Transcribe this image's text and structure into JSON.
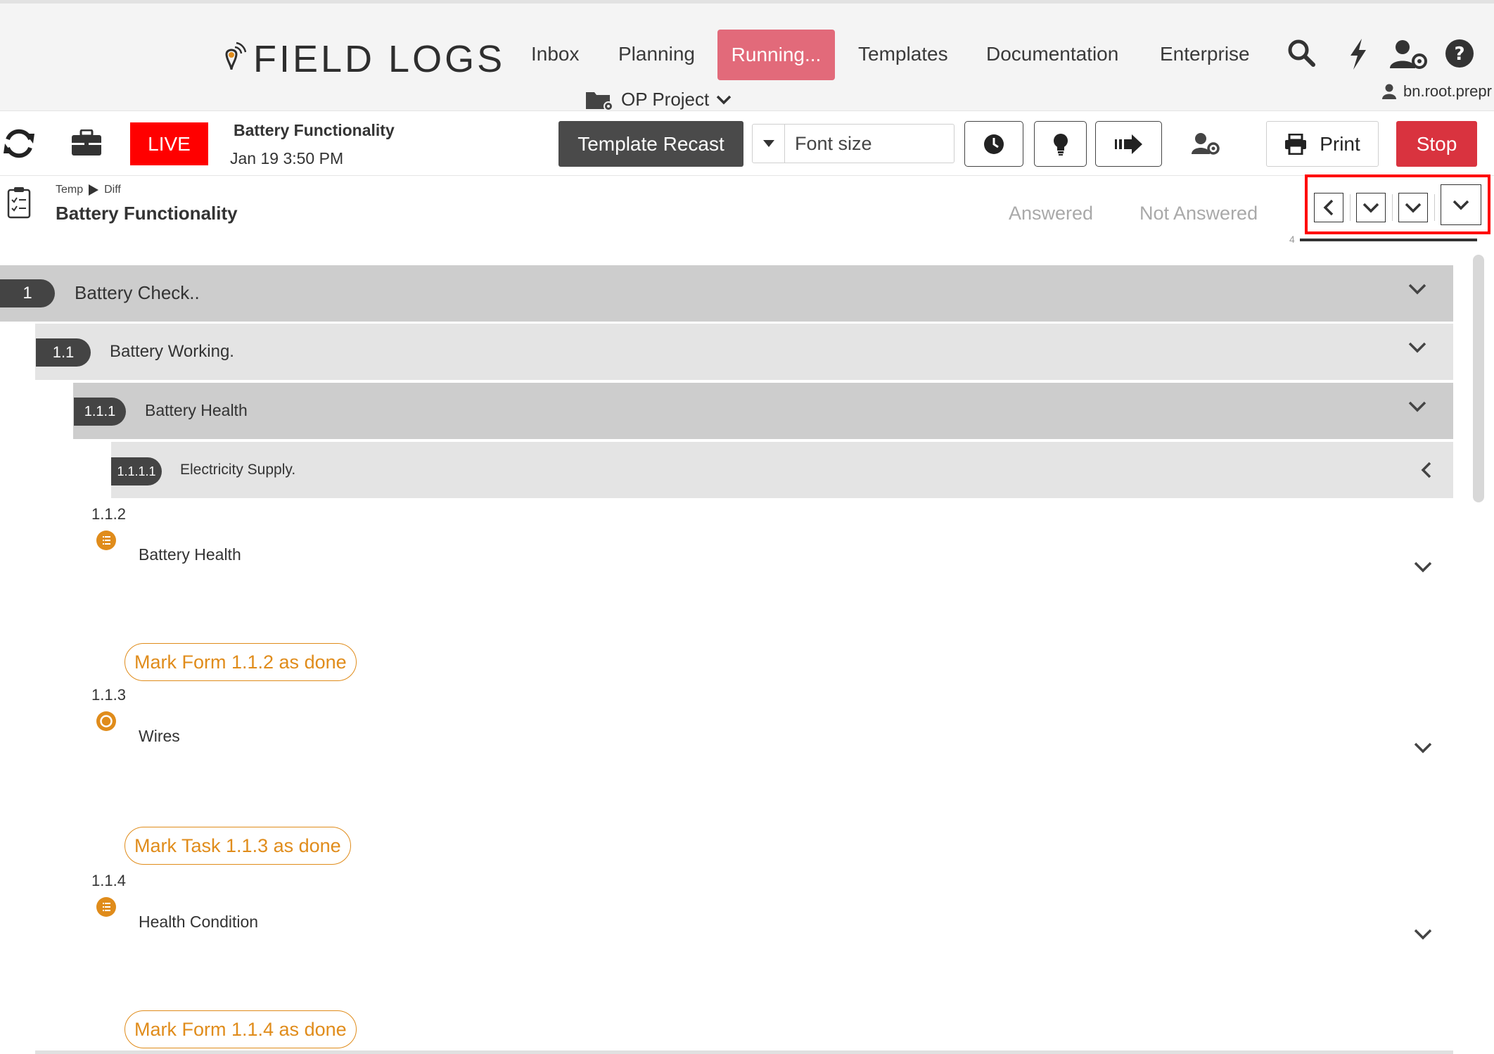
{
  "brand": {
    "name": "FIELD LOGS"
  },
  "nav": {
    "items": [
      "Inbox",
      "Planning",
      "Running...",
      "Templates",
      "Documentation",
      "Enterprise"
    ],
    "project": "OP Project",
    "user": "bn.root.prepr"
  },
  "toolbar": {
    "live_label": "LIVE",
    "doc_title": "Battery Functionality",
    "doc_date": "Jan 19 3:50 PM",
    "recast_label": "Template Recast",
    "font_size_label": "Font size",
    "print_label": "Print",
    "stop_label": "Stop"
  },
  "section_header": {
    "breadcrumb": [
      "Temp",
      "Diff"
    ],
    "title": "Battery Functionality",
    "filters": [
      "Answered",
      "Not Answered"
    ],
    "progress_count": "4"
  },
  "sections": [
    {
      "number": "1",
      "label": "Battery Check..",
      "chevron": "down"
    },
    {
      "number": "1.1",
      "label": "Battery Working.",
      "chevron": "down"
    },
    {
      "number": "1.1.1",
      "label": "Battery Health",
      "chevron": "down"
    },
    {
      "number": "1.1.1.1",
      "label": "Electricity Supply.",
      "chevron": "left"
    }
  ],
  "items": [
    {
      "number": "1.1.2",
      "icon": "form-list-icon",
      "label": "Battery Health",
      "action": "Mark Form 1.1.2 as done"
    },
    {
      "number": "1.1.3",
      "icon": "task-circle-icon",
      "label": "Wires",
      "action": "Mark Task 1.1.3 as done"
    },
    {
      "number": "1.1.4",
      "icon": "form-list-icon",
      "label": "Health Condition",
      "action": "Mark Form 1.1.4 as done"
    }
  ],
  "colors": {
    "accent_orange": "#e08c1b",
    "running_tab": "#e26a7a",
    "live_red": "#ff0000",
    "stop_red": "#d9333f",
    "highlight_box": "#ff0000"
  }
}
